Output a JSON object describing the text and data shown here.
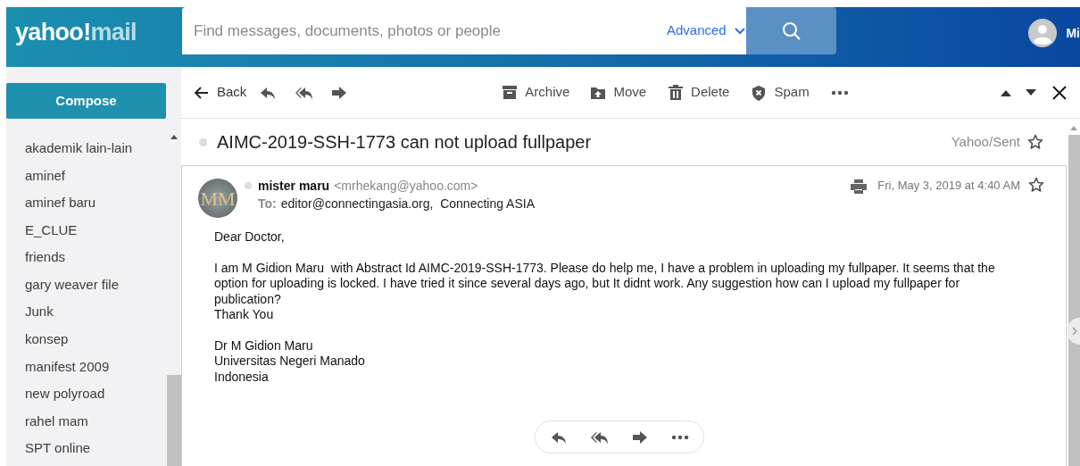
{
  "header": {
    "logo": {
      "brand": "yahoo!",
      "product": "mail"
    },
    "search": {
      "placeholder": "Find messages, documents, photos or people"
    },
    "advanced": "Advanced",
    "user": {
      "name": "Mi"
    }
  },
  "sidebar": {
    "compose": "Compose",
    "folders": [
      "akademik lain-lain",
      "aminef",
      "aminef baru",
      "E_CLUE",
      "friends",
      "gary weaver file",
      "Junk",
      "konsep",
      "manifest 2009",
      "new polyroad",
      "rahel mam",
      "SPT online"
    ]
  },
  "toolbar": {
    "back": "Back",
    "actions": [
      {
        "kind": "archive",
        "label": "Archive"
      },
      {
        "kind": "move",
        "label": "Move"
      },
      {
        "kind": "delete",
        "label": "Delete"
      },
      {
        "kind": "spam",
        "label": "Spam"
      }
    ]
  },
  "message": {
    "subject": "AIMC-2019-SSH-1773 can not upload fullpaper",
    "folder": "Yahoo/Sent",
    "starred": false,
    "sender": {
      "initials": "MM",
      "name": "mister maru",
      "email": "<mrhekang@yahoo.com>"
    },
    "to_label": "To:",
    "recipients": "editor@connectingasia.org,  Connecting ASIA",
    "date": "Fri, May 3, 2019 at 4:40 AM",
    "date_starred": false,
    "body": [
      [
        "Dear Doctor,"
      ],
      [
        "I am M Gidion Maru  with Abstract Id AIMC-2019-SSH-1773. Please do help me, I have a problem in uploading my fullpaper. It seems that the option for uploading is locked. I have tried it since several days ago, but It didnt work. Any suggestion how can I upload my fullpaper for publication?",
        "Thank You"
      ],
      [
        "Dr M Gidion Maru",
        "Universitas Negeri Manado",
        "Indonesia"
      ]
    ]
  }
}
